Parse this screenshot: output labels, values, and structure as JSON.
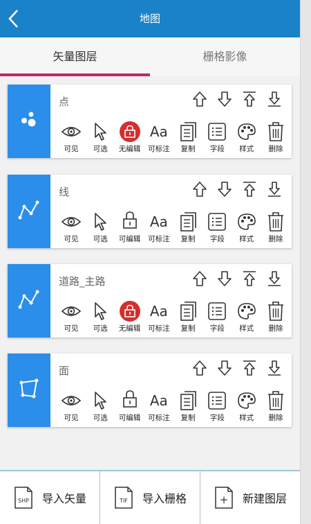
{
  "header": {
    "title": "地图",
    "back_icon": "chevron-left-icon"
  },
  "tabs": [
    {
      "label": "矢量图层",
      "active": true
    },
    {
      "label": "栅格影像",
      "active": false
    }
  ],
  "actions": {
    "visible": "可见",
    "selectable": "可选",
    "editable": "可编辑",
    "not_editable": "无编辑",
    "label": "可标注",
    "copy": "复制",
    "fields": "字段",
    "style": "样式",
    "delete": "删除"
  },
  "label_glyph": "Aa",
  "layers": [
    {
      "name": "点",
      "type": "point",
      "edit_label": "无编辑",
      "locked": true
    },
    {
      "name": "线",
      "type": "line",
      "edit_label": "可编辑",
      "locked": false
    },
    {
      "name": "道路_主路",
      "type": "line",
      "edit_label": "无编辑",
      "locked": true
    },
    {
      "name": "面",
      "type": "polygon",
      "edit_label": "可编辑",
      "locked": false
    }
  ],
  "bottom": {
    "import_vector": {
      "label": "导入矢量",
      "icon_text": "SHP"
    },
    "import_raster": {
      "label": "导入栅格",
      "icon_text": "TIF"
    },
    "new_layer": {
      "label": "新建图层",
      "icon_text": "+"
    }
  },
  "colors": {
    "header": "#1a82c8",
    "accent_tab": "#c0266a",
    "layer_side": "#2a8eea",
    "locked": "#d32f2f"
  }
}
